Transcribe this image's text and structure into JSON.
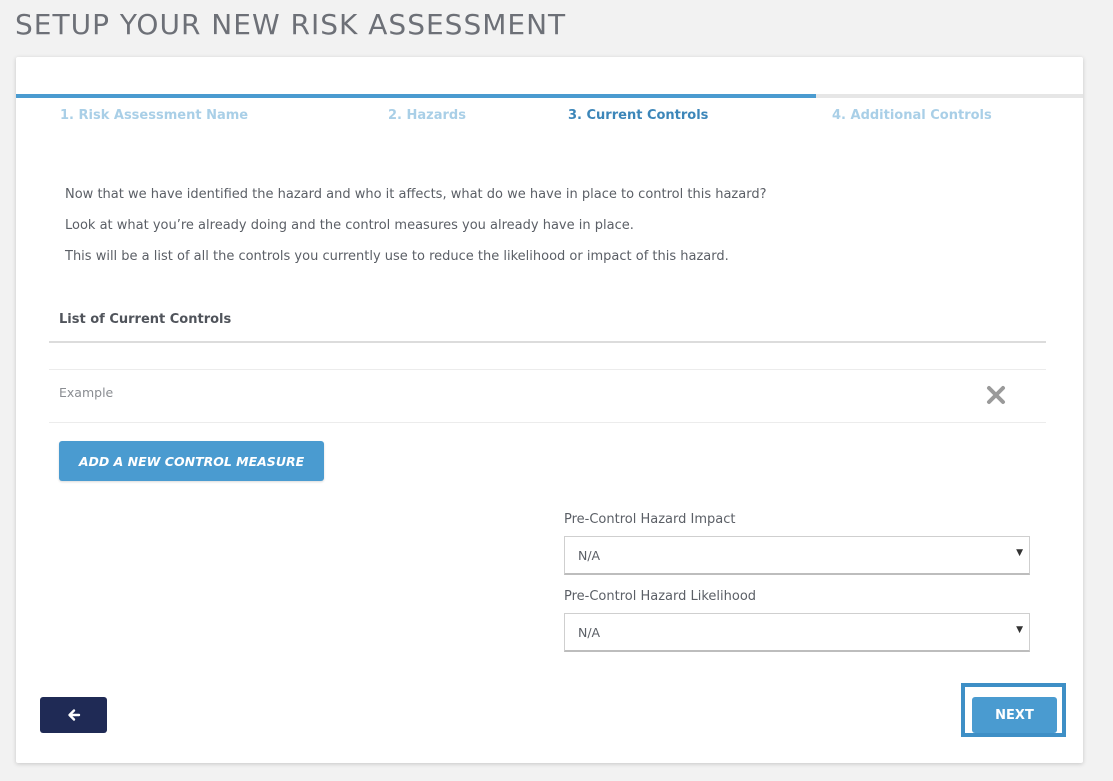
{
  "page": {
    "title": "SETUP YOUR NEW RISK ASSESSMENT"
  },
  "wizard": {
    "progress_fraction": 0.75,
    "steps": [
      {
        "label": "1. Risk Assessment Name",
        "state": "completed"
      },
      {
        "label": "2. Hazards",
        "state": "completed"
      },
      {
        "label": "3. Current Controls",
        "state": "active"
      },
      {
        "label": "4. Additional Controls",
        "state": "upcoming"
      }
    ]
  },
  "intro": [
    "Now that we have identified the hazard and who it affects, what do we have in place to control this hazard?",
    "Look at what you’re already doing and the control measures you already have in place.",
    "This will be a list of all the controls you currently use to reduce the likelihood or impact of this hazard."
  ],
  "controls": {
    "heading": "List of Current Controls",
    "items": [
      {
        "name": "Example",
        "remove_icon": "close-icon"
      }
    ],
    "add_button_label": "ADD A NEW CONTROL MEASURE"
  },
  "fields": {
    "impact": {
      "label": "Pre-Control Hazard Impact",
      "value": "N/A"
    },
    "likelihood": {
      "label": "Pre-Control Hazard Likelihood",
      "value": "N/A"
    }
  },
  "nav": {
    "back_icon": "arrow-left-icon",
    "next_label": "NEXT"
  },
  "colors": {
    "primary": "#4a9bd0",
    "navy": "#1f2a55",
    "step_active": "#3c86b9",
    "step_inactive": "#a9cfe7"
  }
}
